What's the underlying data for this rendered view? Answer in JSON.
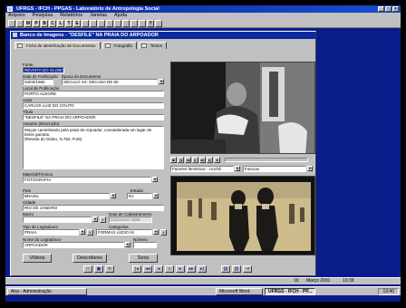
{
  "app": {
    "title": "UFRGS  -  IFCH  -  PPGAS  -  Laboratório de Antropologia Social",
    "menu": [
      "Arquivo",
      "Pesquisa",
      "Relatórios",
      "Janelas",
      "Ajuda"
    ],
    "toolbar_letters": [
      "M",
      "P",
      "B",
      "C",
      "L",
      "T",
      "E"
    ]
  },
  "doc": {
    "title": "Banco de Imagens - \"DESFILE\" NA PRAIA DO ARPOADOR",
    "tabs": [
      "Ficha de Identificação de Documentos",
      "Fotografia",
      "Textos"
    ]
  },
  "form": {
    "fonte_label": "Fonte",
    "fonte_value": "REVISTA DO GLOBO",
    "data_pub_label": "Data de Publicação",
    "data_pub_value": "04/03/1960",
    "epoca_label": "Época do Documento",
    "epoca_value": "SÉCULO XX: DÉCADA DE 60",
    "local_label": "Local de Publicação",
    "local_value": "PORTO ALEGRE",
    "autor_label": "Autor",
    "autor_value": "CARLOS LUIZ DO COUTO",
    "titulo_label": "Título",
    "titulo_value": "\"DESFILE\" NA PRAIA DO ARPOADOR",
    "assunto_label": "Assunto (Descrição)",
    "assunto_value": "Moças caminhando pela praia do Arpoador, consiederada um lugar de belos garotas.\n(Revista do Globo, N.762, P.26)",
    "material_label": "Material/Técnica",
    "material_value": "FOTOGRAFIA",
    "pais_label": "País",
    "pais_value": "BRASIL",
    "estado_label": "Estado",
    "estado_value": "RJ",
    "cidade_label": "Cidade",
    "cidade_value": "RIO DE JANEIRO",
    "bairro_label": "Bairro",
    "data_cad_label": "Data de Cadastramento",
    "data_cad_value": "13/JULHO 1999",
    "tipo_log_label": "Tipo de Logradouro",
    "tipo_log_value": "PRAIA",
    "categorias_label": "Categorias",
    "categorias_value": "FORMAS LÚDICAS",
    "nome_log_label": "Nome do Logradouro",
    "nome_log_value": "ARPOADOR",
    "numero_label": "Número"
  },
  "buttons": {
    "videos": "Vídeos",
    "descritores": "Descritores",
    "sons": "Sons"
  },
  "media": {
    "select1": "Fazeres femininos : crochê",
    "select2": "Fotocas"
  },
  "statusbar": {
    "count": "16",
    "date": "Março 2001",
    "time": "13:39"
  },
  "taskbar": {
    "items": [
      "Ana - Administração",
      "Microsoft Word",
      "UFRGS - IFCH - PP..."
    ],
    "tray_time": "13:40"
  }
}
